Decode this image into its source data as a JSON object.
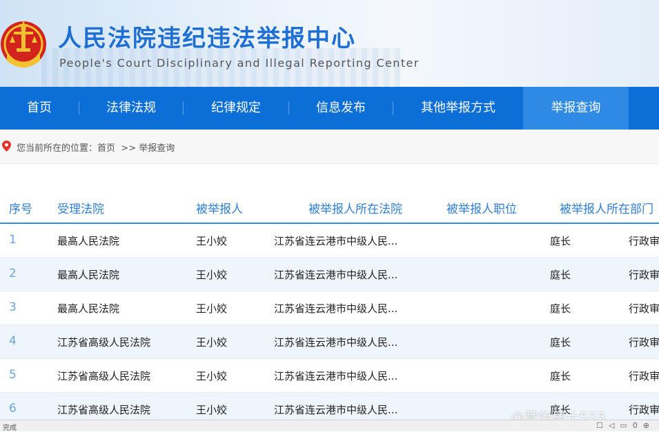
{
  "header": {
    "title": "人民法院违纪违法举报中心",
    "subtitle": "People's Court Disciplinary and Illegal Reporting Center"
  },
  "nav": {
    "items": [
      {
        "label": "首页"
      },
      {
        "label": "法律法规"
      },
      {
        "label": "纪律规定"
      },
      {
        "label": "信息发布"
      },
      {
        "label": "其他举报方式"
      },
      {
        "label": "举报查询",
        "active": true
      }
    ]
  },
  "breadcrumb": {
    "prefix": "您当前所在的位置：",
    "home": "首页",
    "separator": ">>",
    "current": "举报查询"
  },
  "table": {
    "headers": [
      "序号",
      "受理法院",
      "被举报人",
      "被举报人所在法院",
      "被举报人职位",
      "被举报人所在部门"
    ],
    "rows": [
      {
        "idx": "1",
        "court": "最高人民法院",
        "person": "王小姣",
        "person_court": "江苏省连云港市中级人民...",
        "position": "庭长",
        "dept": "行政审"
      },
      {
        "idx": "2",
        "court": "最高人民法院",
        "person": "王小姣",
        "person_court": "江苏省连云港市中级人民...",
        "position": "庭长",
        "dept": "行政审"
      },
      {
        "idx": "3",
        "court": "最高人民法院",
        "person": "王小姣",
        "person_court": "江苏省连云港市中级人民...",
        "position": "庭长",
        "dept": "行政审"
      },
      {
        "idx": "4",
        "court": "江苏省高级人民法院",
        "person": "王小姣",
        "person_court": "江苏省连云港市中级人民...",
        "position": "庭长",
        "dept": "行政审"
      },
      {
        "idx": "5",
        "court": "江苏省高级人民法院",
        "person": "王小姣",
        "person_court": "江苏省连云港市中级人民...",
        "position": "庭长",
        "dept": "行政审"
      },
      {
        "idx": "6",
        "court": "江苏省高级人民法院",
        "person": "王小姣",
        "person_court": "江苏省连云港市中级人民...",
        "position": "庭长",
        "dept": "行政审"
      }
    ]
  },
  "statusbar": {
    "left": "完成",
    "zoom": "0"
  },
  "watermark": "@慧怡居士555",
  "colors": {
    "primary": "#0b6fd7",
    "nav_active": "#2f8ae6",
    "title": "#1f6ed4",
    "header_text": "#2f7fd6",
    "alt_row": "#eef5fc",
    "emblem_red": "#d2231c",
    "emblem_gold": "#f2c230"
  }
}
